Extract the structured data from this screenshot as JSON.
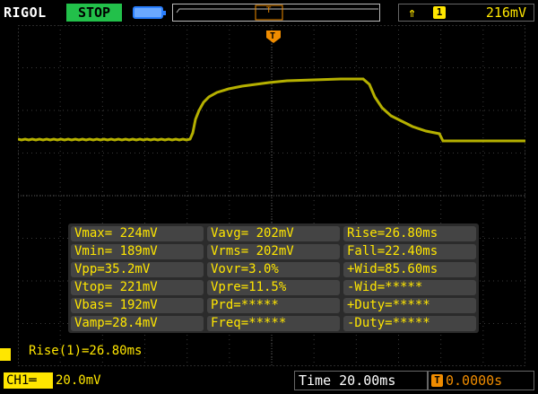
{
  "header": {
    "brand": "RIGOL",
    "run_state": "STOP",
    "run_state_color": "#22c04a",
    "trigger": {
      "edge_icon": "rising-edge-icon",
      "channel": "1",
      "level": "216mV",
      "color": "#ffe600"
    }
  },
  "trigger_marker": {
    "label": "T",
    "color": "#f08c00"
  },
  "waveform": {
    "color": "#b5b000",
    "shape": "step up, plateau, step down"
  },
  "measurements": {
    "rows": [
      [
        "Vmax= 224mV",
        "Vavg= 202mV",
        "Rise=26.80ms"
      ],
      [
        "Vmin= 189mV",
        "Vrms= 202mV",
        "Fall=22.40ms"
      ],
      [
        "Vpp=35.2mV",
        "Vovr=3.0%",
        "+Wid=85.60ms"
      ],
      [
        "Vtop= 221mV",
        "Vpre=11.5%",
        "-Wid=*****"
      ],
      [
        "Vbas= 192mV",
        "Prd=*****",
        "+Duty=*****"
      ],
      [
        "Vamp=28.4mV",
        "Freq=*****",
        "-Duty=*****"
      ]
    ]
  },
  "active_measure": "Rise(1)=26.80ms",
  "footer": {
    "channel_label": "CH1",
    "coupling_icon": "dc-coupling-icon",
    "channel_scale": "20.0mV",
    "timebase": "Time 20.00ms",
    "trigger_offset_icon": "T",
    "trigger_offset": "0.0000s"
  }
}
